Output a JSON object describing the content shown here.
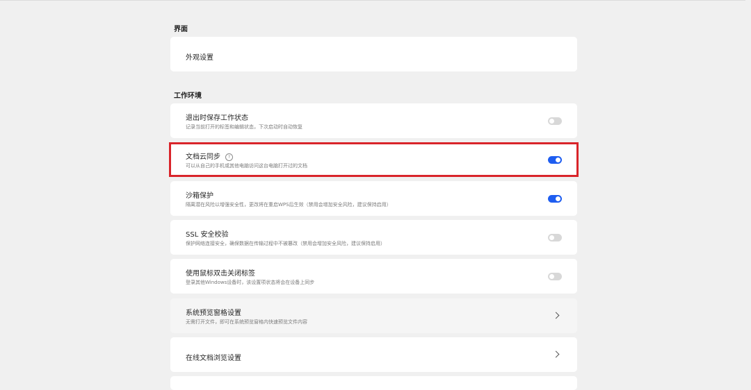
{
  "sections": {
    "interface": {
      "title": "界面",
      "items": [
        {
          "label": "外观设置"
        }
      ]
    },
    "work_env": {
      "title": "工作环境",
      "items": [
        {
          "label": "退出时保存工作状态",
          "desc": "记录当前打开的标签和编辑状态，下次启动时自动恢复",
          "toggle": "off"
        },
        {
          "label": "文档云同步",
          "desc": "可以从自己的手机或其他电脑访问这台电脑打开过的文档",
          "toggle": "on",
          "help_icon": "?"
        },
        {
          "label": "沙箱保护",
          "desc": "隔离潜在风险以增强安全性，更改将在重启WPS后生效（禁用会增加安全风险，建议保持启用）",
          "toggle": "on"
        },
        {
          "label": "SSL 安全校验",
          "desc": "保护网络连接安全，确保数据在传输过程中不被篡改（禁用会增加安全风险，建议保持启用）",
          "toggle": "off"
        },
        {
          "label": "使用鼠标双击关闭标签",
          "desc": "登录其他Windows设备时，该设置项状态将会在设备上同步",
          "toggle": "off"
        },
        {
          "label": "系统预览窗格设置",
          "desc": "无需打开文件，即可在系统预览窗格内快速预览文件内容",
          "chevron": true
        },
        {
          "label": "在线文档浏览设置",
          "chevron": true
        }
      ]
    }
  },
  "colors": {
    "accent": "#1e5df0",
    "highlight_border": "#d9242a",
    "toggle_off": "#d8d8d8"
  }
}
